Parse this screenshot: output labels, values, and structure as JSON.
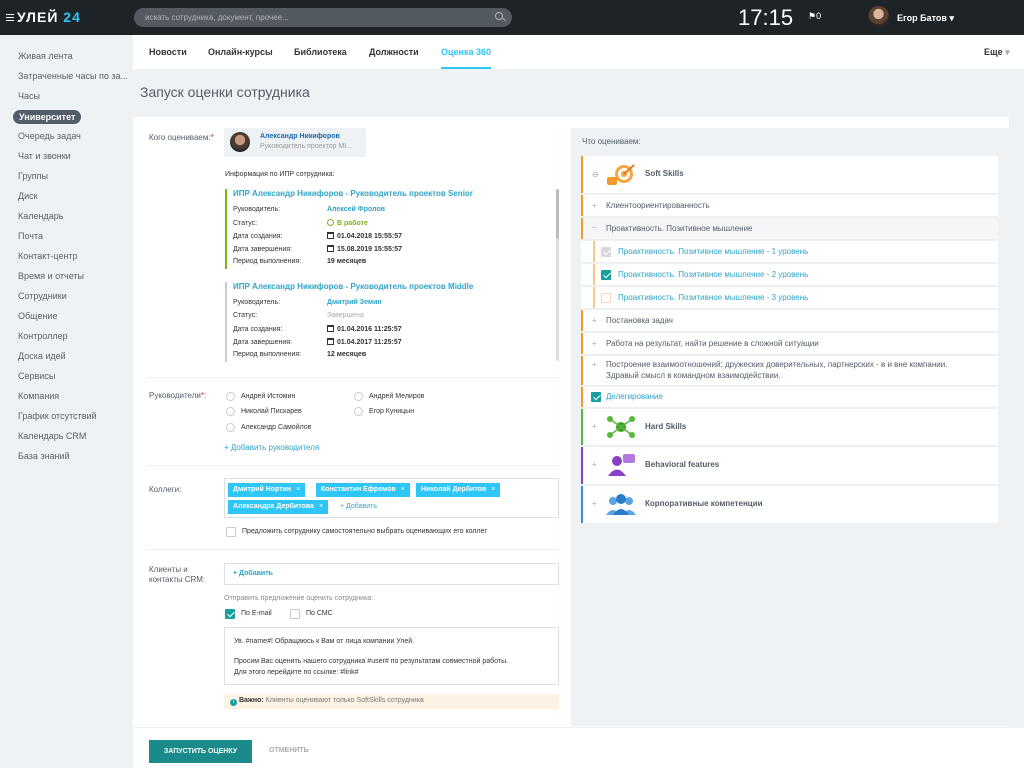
{
  "app": {
    "logo_text": "УЛЕЙ",
    "logo_num": "24"
  },
  "top": {
    "search_placeholder": "искать сотрудника, документ, прочее...",
    "time": "17:15",
    "flag_count": "0",
    "user_name": "Егор Батов"
  },
  "sidebar": {
    "items": [
      {
        "label": "Живая лента"
      },
      {
        "label": "Затраченные часы по за..."
      },
      {
        "label": "Часы"
      },
      {
        "label": "Университет",
        "active": true
      },
      {
        "label": "Очередь задач"
      },
      {
        "label": "Чат и звонки"
      },
      {
        "label": "Группы"
      },
      {
        "label": "Диск"
      },
      {
        "label": "Календарь"
      },
      {
        "label": "Почта"
      },
      {
        "label": "Контакт-центр"
      },
      {
        "label": "Время и отчеты"
      },
      {
        "label": "Сотрудники"
      },
      {
        "label": "Общение"
      },
      {
        "label": "Контроллер"
      },
      {
        "label": "Доска идей"
      },
      {
        "label": "Сервисы"
      },
      {
        "label": "Компания"
      },
      {
        "label": "График отсутствий"
      },
      {
        "label": "Календарь CRM"
      },
      {
        "label": "База знаний"
      }
    ]
  },
  "tabs": [
    {
      "label": "Новости"
    },
    {
      "label": "Онлайн-курсы"
    },
    {
      "label": "Библиотека"
    },
    {
      "label": "Должности"
    },
    {
      "label": "Оценка 360",
      "active": true
    }
  ],
  "more_label": "Еще",
  "page_title": "Запуск оценки сотрудника",
  "form": {
    "who_label": "Кого оцениваем:",
    "req_mark": "*",
    "person": {
      "name": "Александр Никифоров",
      "position": "Руководитель проектор Ml..."
    },
    "ipr_info_label": "Информация по ИПР сотрудника:",
    "ipr": [
      {
        "title": "ИПР Александр Никифоров - Руководитель проектов Senior",
        "manager_k": "Руководитель:",
        "manager_v": "Алексей Фролов",
        "status_k": "Статус:",
        "status_v": "В работе",
        "created_k": "Дата создания:",
        "created_v": "01.04.2018 15:55:57",
        "finish_k": "Дата завершения:",
        "finish_v": "15.08.2019 15:55:57",
        "period_k": "Период выполнения:",
        "period_v": "19 месяцев",
        "color": "#7ab31a"
      },
      {
        "title": "ИПР Александр Никифоров - Руководитель проектов Middle",
        "manager_k": "Руководитель:",
        "manager_v": "Дмитрий Земин",
        "status_k": "Статус:",
        "status_v": "Завершена",
        "created_k": "Дата создания:",
        "created_v": "01.04.2016 11:25:57",
        "finish_k": "Дата завершения:",
        "finish_v": "01.04.2017 11:25:57",
        "period_k": "Период выполнения:",
        "period_v": "12 месяцев",
        "color": "#c7ccd1"
      }
    ],
    "managers_label": "Руководители",
    "managers": [
      "Андрей Истомин",
      "Андрей Мелиров",
      "Николай Пискарев",
      "Егор Куницын",
      "Александр Самойлов"
    ],
    "add_manager": "+ Добавить руководителя",
    "colleagues_label": "Коллеги:",
    "colleagues": [
      "Дмитрий Нортин",
      "Константин Ефремов",
      "Николай Дербитов",
      "Александра Дербитова"
    ],
    "tag_x": "×",
    "add_colleague": "+ Добавить",
    "self_choose": "Предложить сотруднику самостоятельно выбрать оценивающих его коллег",
    "clients_label_1": "Клиенты и",
    "clients_label_2": "контакты CRM:",
    "add_client": "+ Добавить",
    "send_label": "Отправить предложение оценить сотрудника:",
    "by_email": "По E-mail",
    "by_sms": "По СМС",
    "message_1": "Ув. #name#! Обращаюсь к Вам от лица компании Улей.",
    "message_2": "Просим Вас оценить нашего сотрудника #user# по результатам совместной работы.",
    "message_3": "Для этого перейдите по ссылке: #link#",
    "note_bold": "Важно:",
    "note_text": "Клиенты оценивают только SoftSkills сотрудника"
  },
  "right": {
    "title": "Что оцениваем:",
    "soft": "Soft Skills",
    "items": [
      "Клиентоориентированность",
      "Проактивность. Позитивное мышление",
      "Проактивность. Позитивное мышление - 1 уровень",
      "Проактивность. Позитивное мышление - 2 уровень",
      "Проактивность. Позитивное мышление - 3 уровень",
      "Постановка задач",
      "Работа на результат, найти решение в сложной ситуации",
      "Построение взаимоотношений: дружеских доверительных, партнерских - в и вне компании.",
      "Здравый смысл в командном взаимодействии.",
      "Делегирование"
    ],
    "hard": "Hard Skills",
    "behavioral": "Behavioral features",
    "corporate": "Корпоративные компетенции",
    "colors": {
      "soft": "#f39a2b",
      "hard": "#56b93a",
      "behavioral": "#8b3fc6",
      "corporate": "#3a8fd8"
    }
  },
  "footer": {
    "start": "ЗАПУСТИТЬ ОЦЕНКУ",
    "cancel": "ОТМЕНИТЬ"
  }
}
